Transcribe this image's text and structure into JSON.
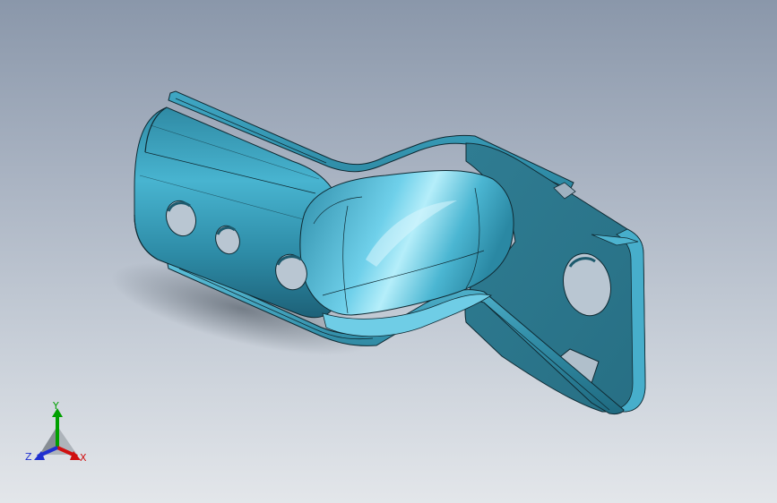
{
  "viewport": {
    "background_top": "#8a97aa",
    "background_bottom": "#e3e6ea"
  },
  "part": {
    "color_base": "#2e7f96",
    "color_mid": "#3fa3c2",
    "color_highlight": "#9fe6f7",
    "edge_color": "#0f2a33",
    "hole_color": "#b9c6d2"
  },
  "triad": {
    "x_label": "X",
    "y_label": "Y",
    "z_label": "Z",
    "x_color": "#d01010",
    "y_color": "#00a000",
    "z_color": "#2030d0",
    "icon": "coordinate-triad-icon"
  }
}
